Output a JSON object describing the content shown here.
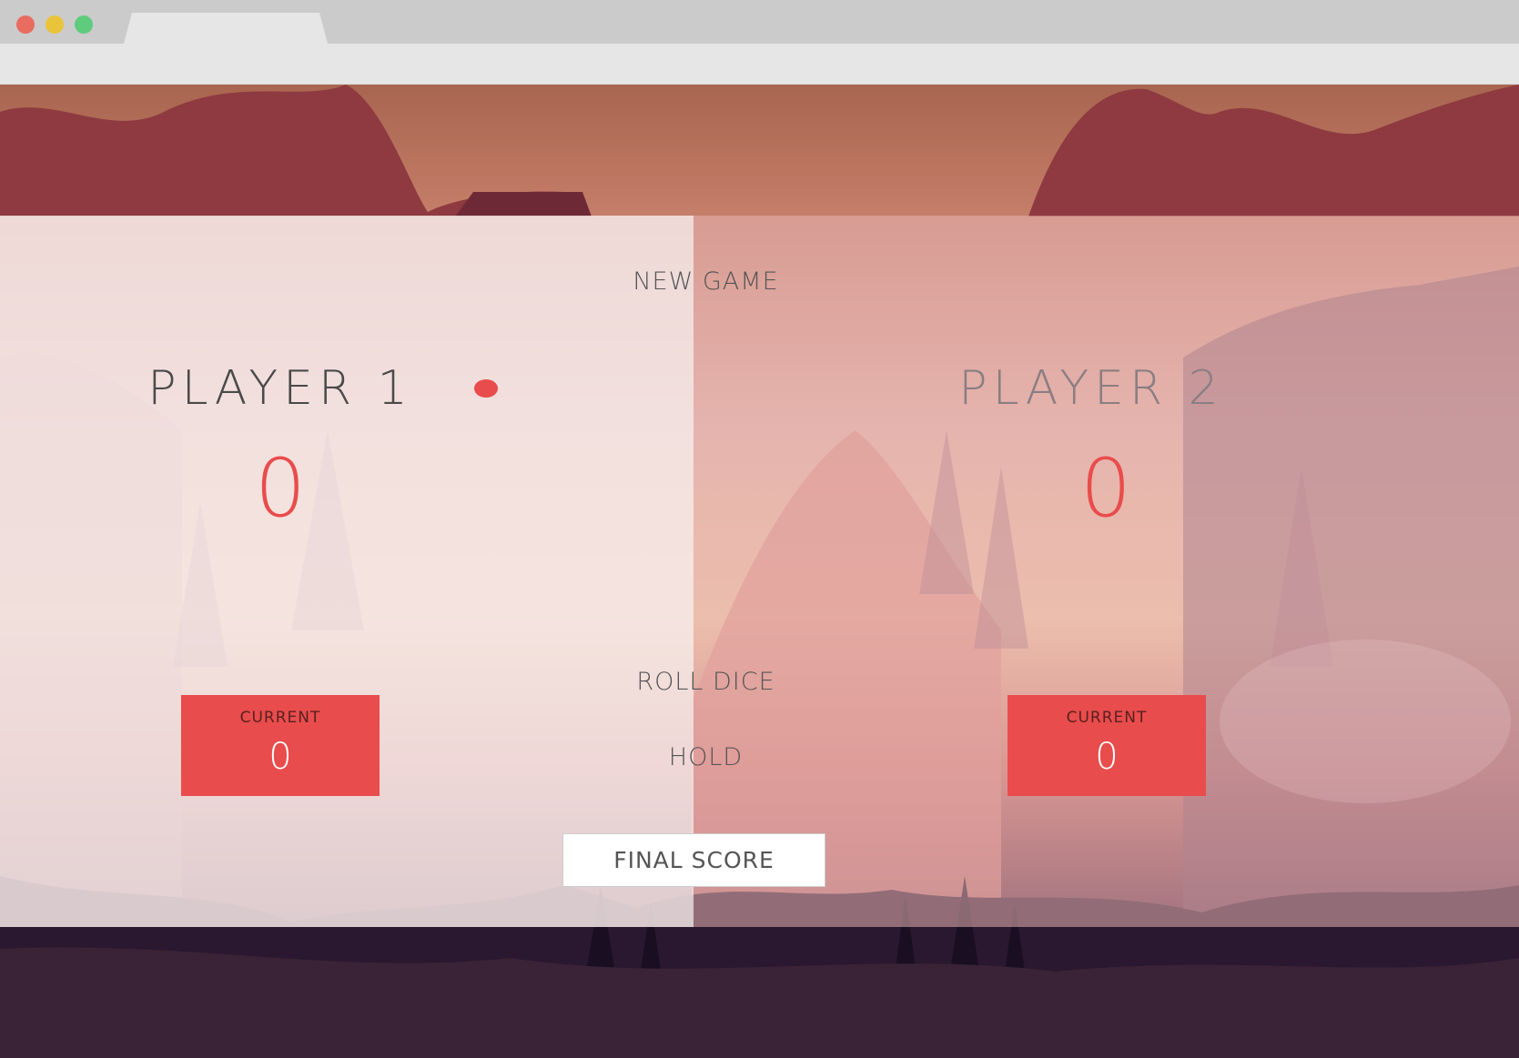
{
  "browser": {
    "tab_title": ""
  },
  "game": {
    "new_game_label": "NEW GAME",
    "roll_dice_label": "ROLL DICE",
    "hold_label": "HOLD",
    "final_score_value": "FINAL SCORE",
    "active_player": 1,
    "players": [
      {
        "name": "PLAYER 1",
        "score": "0",
        "current_label": "CURRENT",
        "current_score": "0"
      },
      {
        "name": "PLAYER 2",
        "score": "0",
        "current_label": "CURRENT",
        "current_score": "0"
      }
    ]
  },
  "colors": {
    "accent": "#e94c4c",
    "active_panel": "#f5e8e8",
    "inactive_panel": "#e8b4b4"
  }
}
